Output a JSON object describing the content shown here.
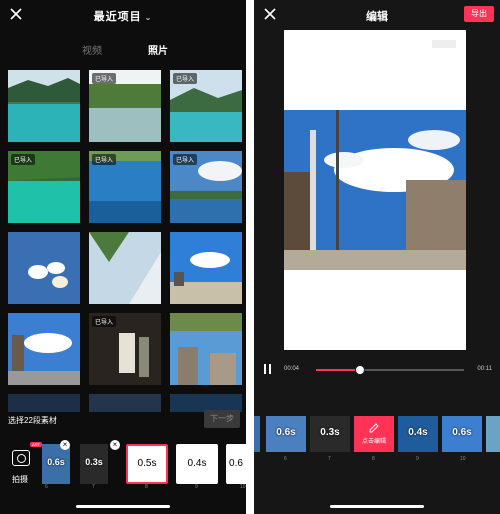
{
  "left": {
    "title": "最近项目",
    "tabs": {
      "video": "视频",
      "photo": "照片"
    },
    "imported_tag": "已导入",
    "selected_label": "选择22段素材",
    "next_button": "下一步",
    "camera_label": "拍摄",
    "camera_badge": "ART",
    "strip": [
      {
        "duration": "0.6s",
        "index": "6"
      },
      {
        "duration": "0.3s",
        "index": "7"
      },
      {
        "duration": "0.5s",
        "index": "8"
      },
      {
        "duration": "0.4s",
        "index": "9"
      },
      {
        "duration": "0.6",
        "index": "10"
      }
    ]
  },
  "right": {
    "title": "编辑",
    "export_button": "导出",
    "time_current": "00:04",
    "time_total": "00:11",
    "progress": 0.3,
    "timeline": [
      {
        "duration": "0.6s",
        "index": "6"
      },
      {
        "duration": "0.3s",
        "index": "7"
      },
      {
        "duration": "",
        "index": "8",
        "edit_label": "点击编辑"
      },
      {
        "duration": "0.4s",
        "index": "9"
      },
      {
        "duration": "0.6s",
        "index": "10"
      }
    ]
  }
}
